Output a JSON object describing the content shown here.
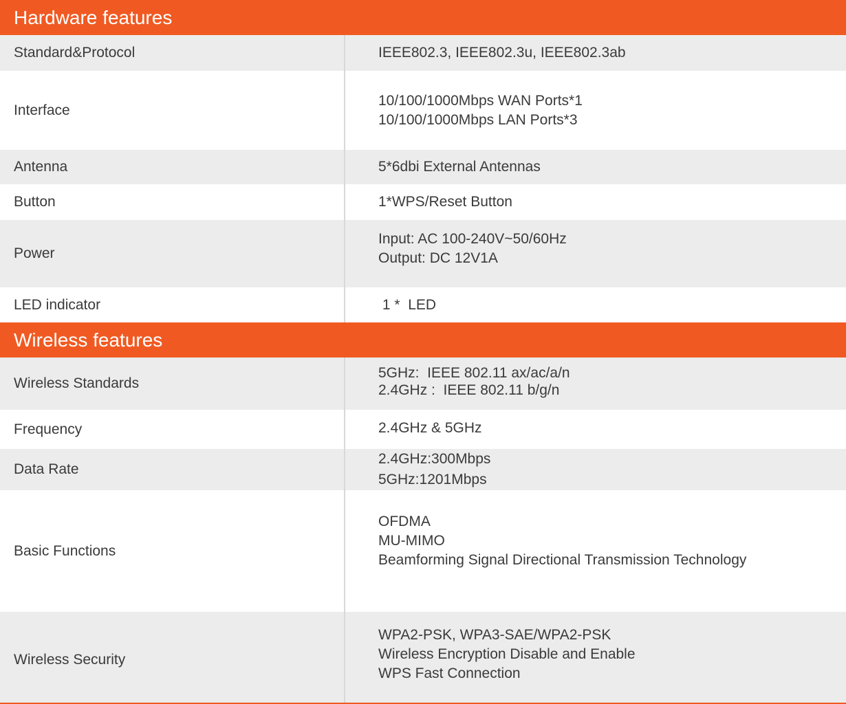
{
  "hardware": {
    "title": "Hardware features",
    "rows": [
      {
        "label": "Standard&Protocol",
        "values": [
          "IEEE802.3, IEEE802.3u, IEEE802.3ab"
        ]
      },
      {
        "label": "Interface",
        "values": [
          "10/100/1000Mbps WAN Ports*1",
          "10/100/1000Mbps LAN Ports*3"
        ]
      },
      {
        "label": "Antenna",
        "values": [
          "5*6dbi External Antennas"
        ]
      },
      {
        "label": "Button",
        "values": [
          "1*WPS/Reset Button"
        ]
      },
      {
        "label": "Power",
        "values": [
          "Input: AC 100-240V~50/60Hz",
          "Output: DC 12V1A"
        ]
      },
      {
        "label": "LED indicator",
        "values": [
          " 1 *  LED"
        ]
      }
    ]
  },
  "wireless": {
    "title": "Wireless features",
    "rows": [
      {
        "label": "Wireless Standards",
        "values": [
          "5GHz:  IEEE 802.11 ax/ac/a/n",
          "2.4GHz :  IEEE 802.11 b/g/n"
        ]
      },
      {
        "label": "Frequency",
        "values": [
          "2.4GHz & 5GHz"
        ]
      },
      {
        "label": "Data Rate",
        "values": [
          "2.4GHz:300Mbps",
          "5GHz:1201Mbps"
        ]
      },
      {
        "label": "Basic Functions",
        "values": [
          "OFDMA",
          "MU-MIMO",
          "Beamforming Signal Directional Transmission Technology"
        ]
      },
      {
        "label": "Wireless Security",
        "values": [
          "WPA2-PSK, WPA3-SAE/WPA2-PSK",
          "Wireless Encryption Disable and Enable",
          "WPS Fast Connection"
        ]
      }
    ]
  },
  "colors": {
    "accent": "#f05a22",
    "row_shade": "#ececec",
    "text": "#3a3a3a"
  }
}
